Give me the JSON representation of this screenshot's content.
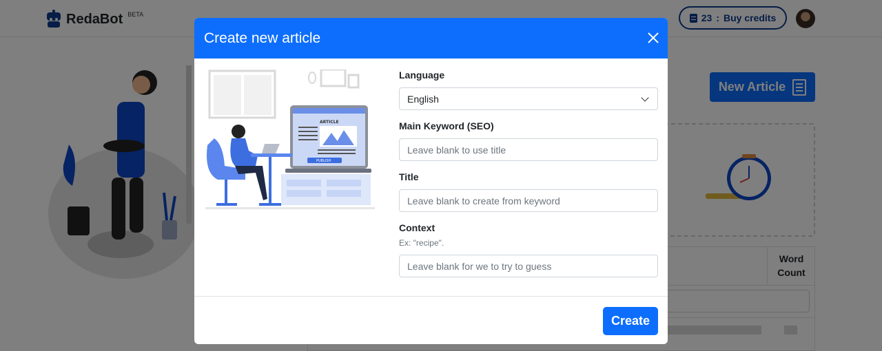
{
  "app": {
    "name": "RedaBot",
    "badge": "BETA"
  },
  "header": {
    "credits_count": "23",
    "credits_separator": ":",
    "credits_label": "Buy credits"
  },
  "page": {
    "new_article_label": "New Article",
    "table": {
      "word_count_header_line1": "Word",
      "word_count_header_line2": "Count"
    }
  },
  "modal": {
    "title": "Create new article",
    "illustration": {
      "article_label": "ARTICLE",
      "publish_label": "PUBLISH"
    },
    "fields": {
      "language": {
        "label": "Language",
        "value": "English"
      },
      "keyword": {
        "label": "Main Keyword (SEO)",
        "placeholder": "Leave blank to use title"
      },
      "title": {
        "label": "Title",
        "placeholder": "Leave blank to create from keyword"
      },
      "context": {
        "label": "Context",
        "hint": "Ex: \"recipe\".",
        "placeholder": "Leave blank for we to try to guess"
      }
    },
    "create_label": "Create"
  },
  "colors": {
    "primary": "#0d6efd",
    "navy": "#0d3a8c",
    "overlay": "rgba(0,0,0,0.5)"
  }
}
